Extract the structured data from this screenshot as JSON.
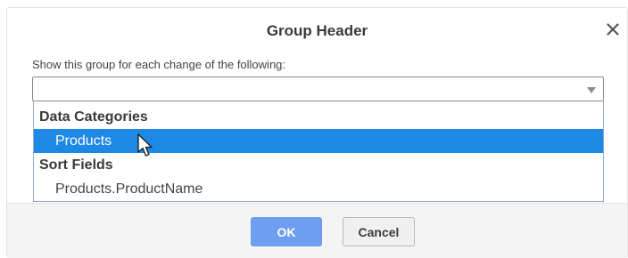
{
  "dialog": {
    "title": "Group Header",
    "close_icon": "close-icon"
  },
  "form": {
    "prompt": "Show this group for each change of the following:",
    "select_value": ""
  },
  "listbox": {
    "groups": [
      {
        "label": "Data Categories",
        "options": [
          {
            "label": "Products",
            "selected": true
          }
        ]
      },
      {
        "label": "Sort Fields",
        "options": [
          {
            "label": "Products.ProductName",
            "selected": false
          }
        ]
      }
    ]
  },
  "footer": {
    "ok_label": "OK",
    "cancel_label": "Cancel"
  },
  "colors": {
    "selected_bg": "#1e88e5",
    "ok_button": "#6e9ef0"
  }
}
